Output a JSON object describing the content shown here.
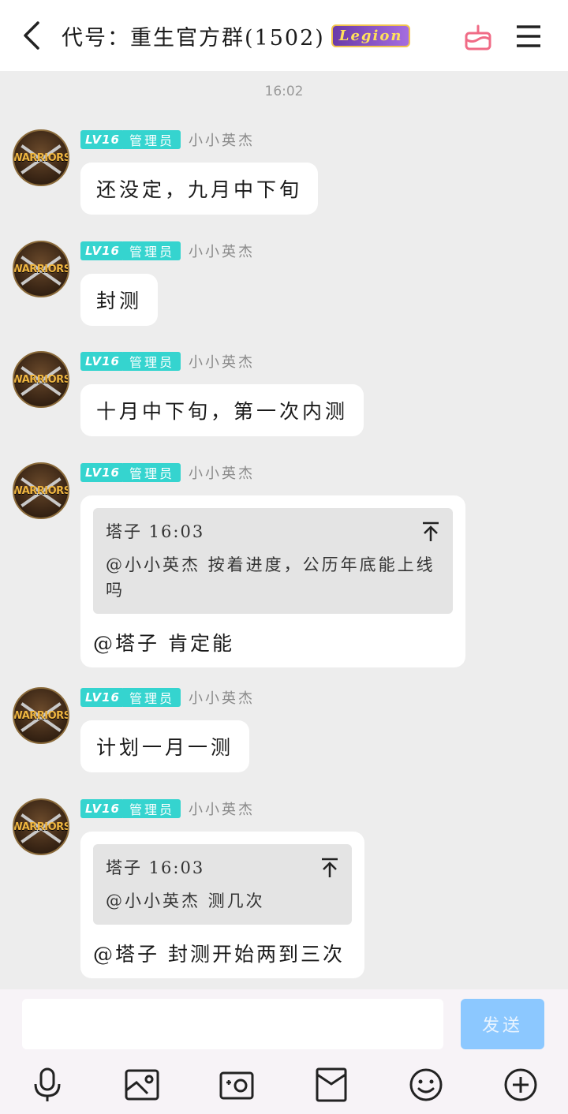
{
  "header": {
    "title": "代号：重生官方群(1502)",
    "badge": "Legion"
  },
  "chat": {
    "timestamp": "16:02",
    "sender": {
      "level": "LV16",
      "role": "管理员",
      "nickname": "小小英杰",
      "avatar_text": "WARRIORS"
    },
    "messages": [
      {
        "text": "还没定，九月中下旬"
      },
      {
        "text": "封测"
      },
      {
        "text": "十月中下旬，第一次内测"
      },
      {
        "quote_head": "塔子 16:03",
        "quote_body": "@小小英杰 按着进度，公历年底能上线吗",
        "reply": "@塔子 肯定能"
      },
      {
        "text": "计划一月一测"
      },
      {
        "quote_head": "塔子 16:03",
        "quote_body": "@小小英杰 测几次",
        "reply": "@塔子 封测开始两到三次"
      }
    ]
  },
  "input": {
    "placeholder": "",
    "send_label": "发送"
  },
  "toolbar": [
    "microphone-icon",
    "image-icon",
    "camera-icon",
    "red-packet-icon",
    "emoji-icon",
    "plus-icon"
  ]
}
